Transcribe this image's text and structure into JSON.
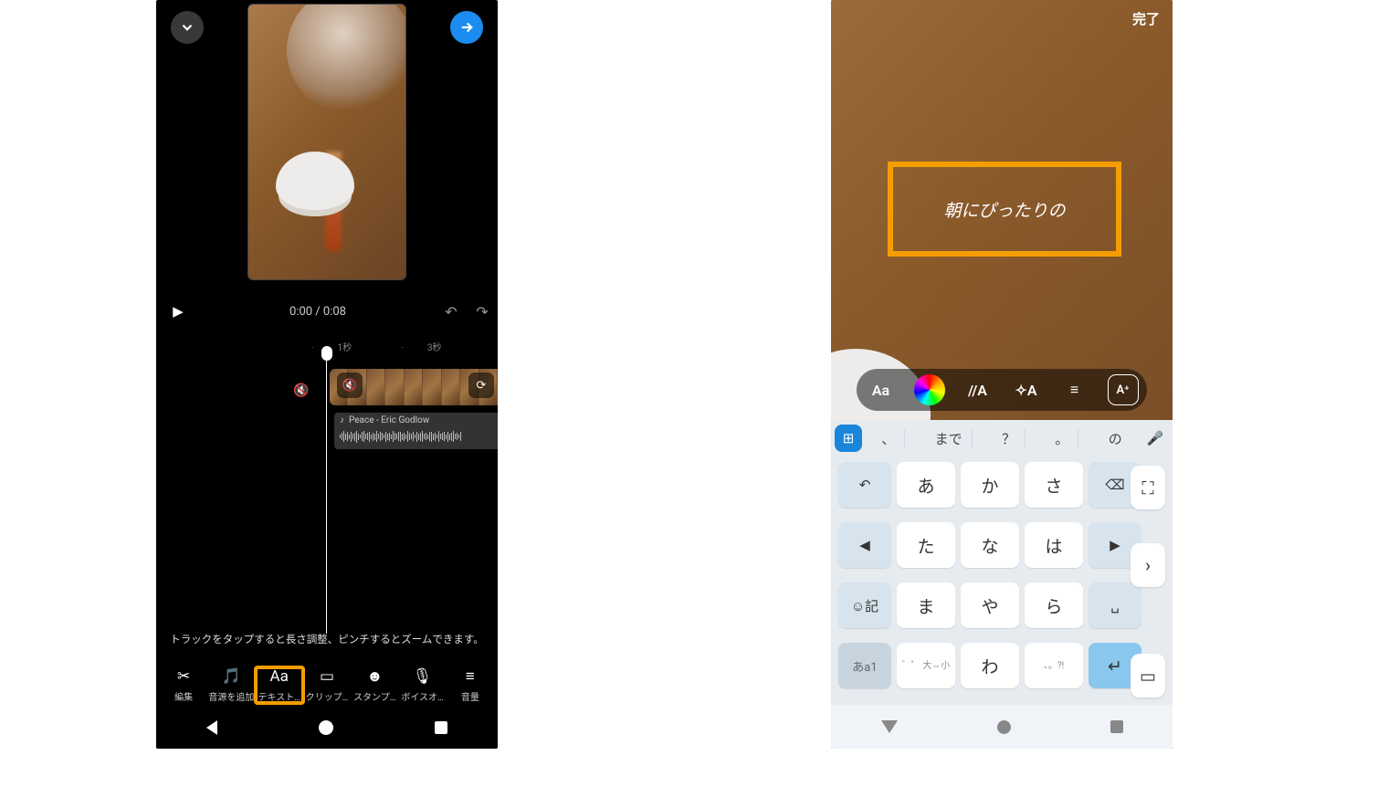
{
  "left": {
    "time": "0:00 / 0:08",
    "ticks": [
      "1秒",
      "3秒"
    ],
    "audio_track": "Peace - Eric Godlow",
    "hint": "トラックをタップすると長さ調整、ピンチするとズームできます。",
    "tools": [
      {
        "icon": "✂",
        "label": "編集"
      },
      {
        "icon": "🎵",
        "label": "音源を追加"
      },
      {
        "icon": "Aa",
        "label": "テキスト…"
      },
      {
        "icon": "▭",
        "label": "クリップ…"
      },
      {
        "icon": "☻",
        "label": "スタンプ…"
      },
      {
        "icon": "🎙",
        "label": "ボイスオ…"
      },
      {
        "icon": "≡",
        "label": "音量"
      }
    ]
  },
  "right": {
    "done": "完了",
    "text_input": "朝にぴったりの",
    "style_bar": [
      "Aa",
      "color",
      "//A",
      "✧A",
      "≡",
      "A⁺"
    ],
    "suggestions": [
      "、",
      "まで",
      "？",
      "。",
      "の"
    ],
    "keyboard": {
      "rows": [
        [
          "↶",
          "あ",
          "か",
          "さ",
          "⌫"
        ],
        [
          "◀",
          "た",
          "な",
          "は",
          "▶"
        ],
        [
          "☺記",
          "ま",
          "や",
          "ら",
          "␣"
        ],
        [
          "あa1",
          "゛゜ 大⇔小",
          "わ",
          "、。?!",
          "↵"
        ]
      ]
    }
  }
}
